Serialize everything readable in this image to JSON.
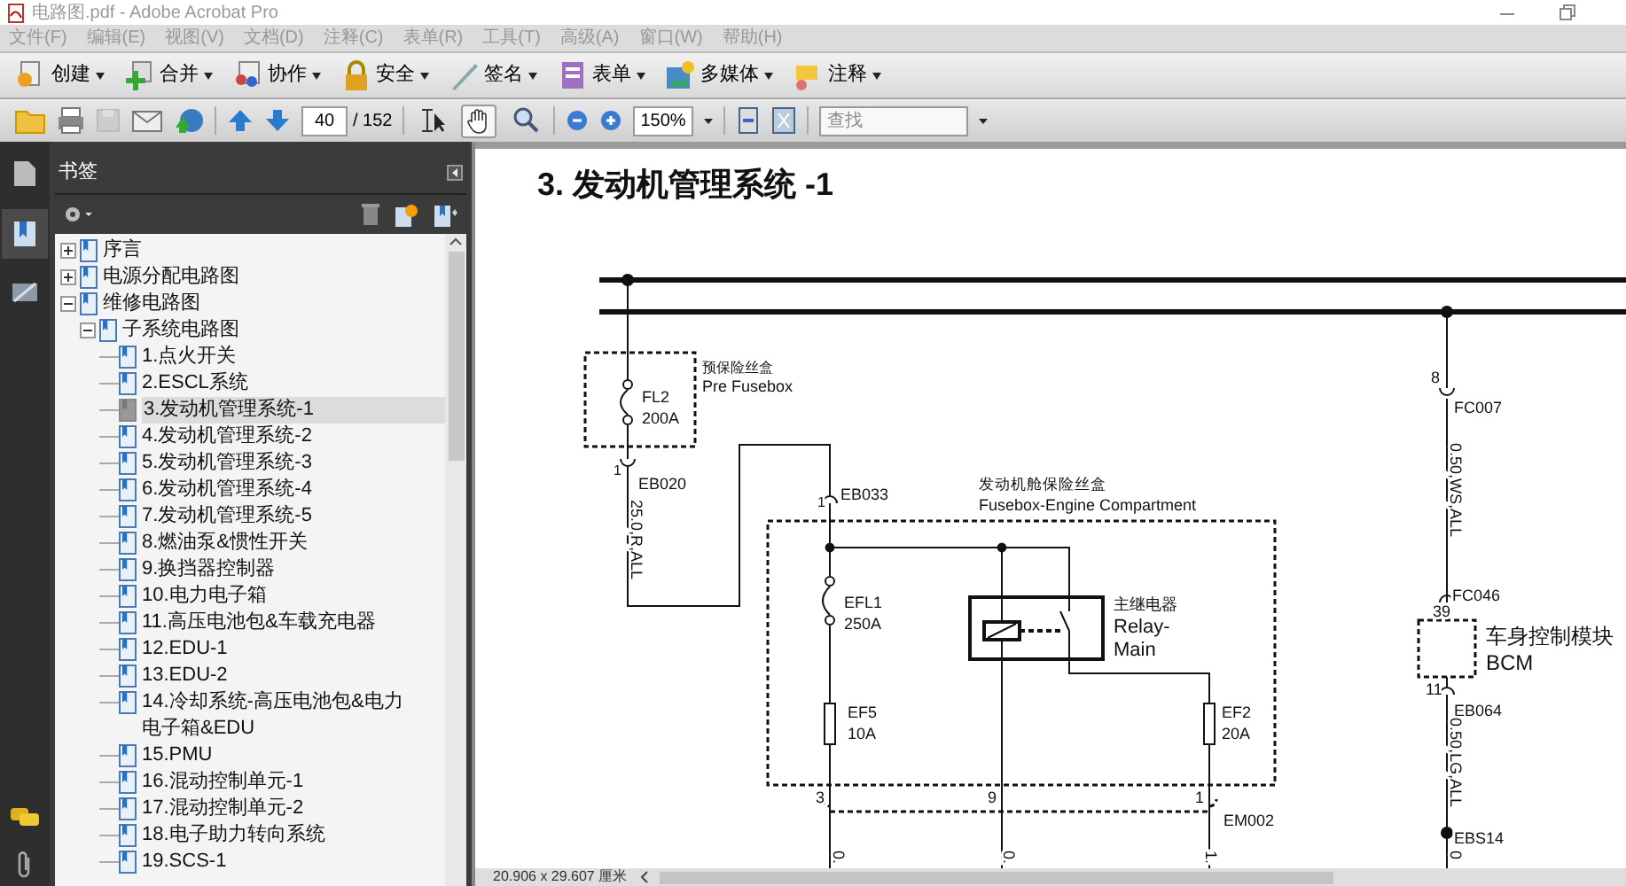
{
  "window": {
    "title": "电路图.pdf - Adobe Acrobat Pro"
  },
  "menu_bar": [
    "文件(F)",
    "编辑(E)",
    "视图(V)",
    "文档(D)",
    "注释(C)",
    "表单(R)",
    "工具(T)",
    "高级(A)",
    "窗口(W)",
    "帮助(H)"
  ],
  "task_toolbar": [
    {
      "kind": "create",
      "label": "创建"
    },
    {
      "kind": "combine",
      "label": "合并"
    },
    {
      "kind": "collaborate",
      "label": "协作"
    },
    {
      "kind": "secure",
      "label": "安全"
    },
    {
      "kind": "sign",
      "label": "签名"
    },
    {
      "kind": "forms",
      "label": "表单"
    },
    {
      "kind": "multimedia",
      "label": "多媒体"
    },
    {
      "kind": "comment",
      "label": "注释"
    }
  ],
  "nav_toolbar": {
    "page": "40",
    "page_count": "/ 152",
    "tools": [
      {
        "kind": "select",
        "selected": false
      },
      {
        "kind": "hand",
        "selected": true
      },
      {
        "kind": "zoom",
        "selected": false
      }
    ],
    "zoom": "150%",
    "search": {
      "placeholder": "查找"
    }
  },
  "sidebar": {
    "title": "书签",
    "bookmarks": [
      {
        "label": "序言",
        "expanded": false,
        "selected": false
      },
      {
        "label": "电源分配电路图",
        "expanded": false,
        "selected": false
      },
      {
        "label": "维修电路图",
        "expanded": true,
        "selected": false,
        "children": [
          {
            "label": "子系统电路图",
            "expanded": true,
            "selected": false,
            "children": [
              {
                "label": "1.点火开关",
                "selected": false
              },
              {
                "label": "2.ESCL系统",
                "selected": false
              },
              {
                "label": "3.发动机管理系统-1",
                "selected": true
              },
              {
                "label": "4.发动机管理系统-2",
                "selected": false
              },
              {
                "label": "5.发动机管理系统-3",
                "selected": false
              },
              {
                "label": "6.发动机管理系统-4",
                "selected": false
              },
              {
                "label": "7.发动机管理系统-5",
                "selected": false
              },
              {
                "label": "8.燃油泵&惯性开关",
                "selected": false
              },
              {
                "label": "9.换挡器控制器",
                "selected": false
              },
              {
                "label": "10.电力电子箱",
                "selected": false
              },
              {
                "label": "11.高压电池包&车载充电器",
                "selected": false
              },
              {
                "label": "12.EDU-1",
                "selected": false
              },
              {
                "label": "13.EDU-2",
                "selected": false
              },
              {
                "label": "14.冷却系统-高压电池包&电力电子箱&EDU",
                "selected": false
              },
              {
                "label": "15.PMU",
                "selected": false
              },
              {
                "label": "16.混动控制单元-1",
                "selected": false
              },
              {
                "label": "17.混动控制单元-2",
                "selected": false
              },
              {
                "label": "18.电子助力转向系统",
                "selected": false
              },
              {
                "label": "19.SCS-1",
                "selected": false
              }
            ]
          }
        ]
      }
    ]
  },
  "document": {
    "title": "3. 发动机管理系统 -1",
    "labels": [
      "预保险丝盒",
      "Pre Fusebox",
      "FL2",
      "200A",
      "1",
      "EB020",
      "25.0,R,ALL",
      "1",
      "EB033",
      "发动机舱保险丝盒",
      "Fusebox-Engine Compartment",
      "EFL1",
      "250A",
      "主继电器",
      "Relay-",
      "Main",
      "EF5",
      "10A",
      "EF2",
      "20A",
      "3",
      "9",
      "1",
      "EM002",
      "0.",
      "0.",
      "1.",
      "8",
      "FC007",
      "0.50,WS,ALL",
      "FC046",
      "39",
      "车身控制模块",
      "BCM",
      "11",
      "EB064",
      "0.50,LG,ALL",
      "EBS14",
      "0"
    ]
  },
  "status_bar": {
    "page_size": "20.906 x 29.607 厘米"
  }
}
